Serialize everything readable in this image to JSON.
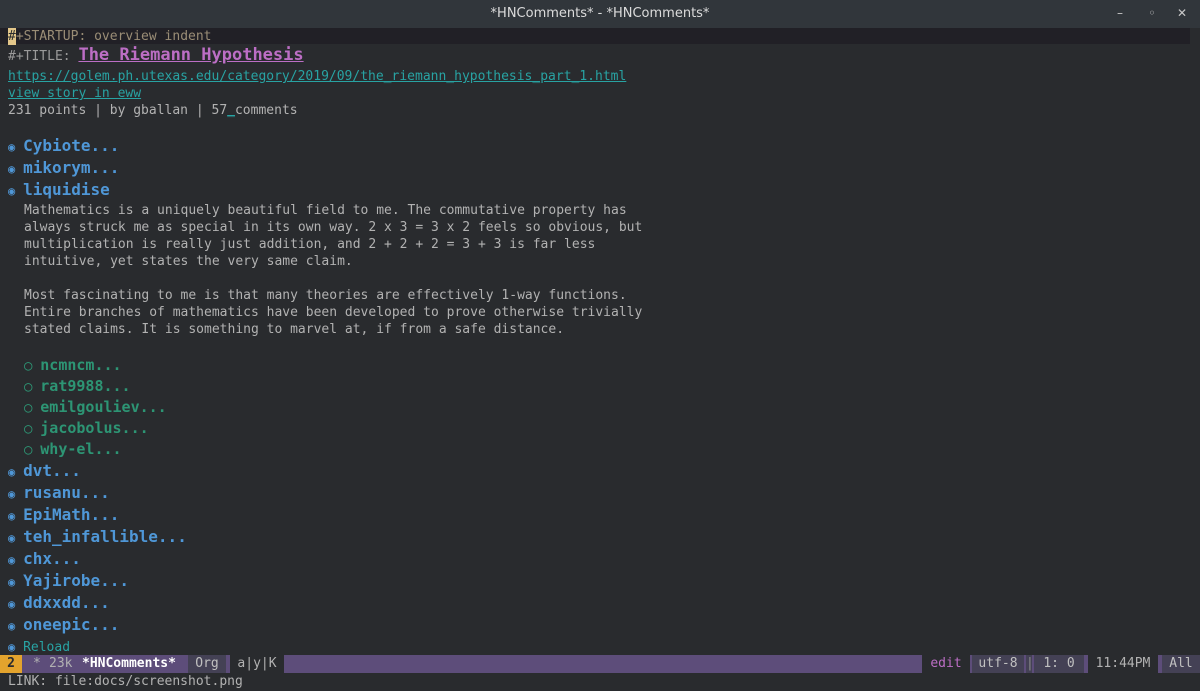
{
  "window": {
    "title": "*HNComments* - *HNComments*",
    "minimize_glyph": "–",
    "restore_glyph": "◦",
    "close_glyph": "✕"
  },
  "buffer": {
    "startup_cursor_char": "#",
    "startup_rest": "+STARTUP: overview indent",
    "title_keyword": "#+TITLE: ",
    "title": "The Riemann Hypothesis",
    "url": "https://golem.ph.utexas.edu/category/2019/09/the_riemann_hypothesis_part_1.html",
    "eww_link": "view story in eww",
    "stats_prefix": "231 points | by gballan | 57",
    "stats_link": "_",
    "stats_suffix": "comments",
    "top_comments": [
      {
        "author": "Cybiote..."
      },
      {
        "author": "mikorym..."
      },
      {
        "author": "liquidise"
      }
    ],
    "comment_body": [
      "Mathematics is a uniquely beautiful field to me. The commutative property has",
      "always struck me as special in its own way. 2 x 3 = 3 x 2 feels so obvious, but",
      "multiplication is really just addition, and 2 + 2 + 2 = 3 + 3 is far less",
      "intuitive, yet states the very same claim.",
      "",
      "Most fascinating to me is that many theories are effectively 1-way functions.",
      "Entire branches of mathematics have been developed to prove otherwise trivially",
      "stated claims. It is something to marvel at, if from a safe distance."
    ],
    "replies": [
      {
        "author": "ncmncm..."
      },
      {
        "author": "rat9988..."
      },
      {
        "author": "emilgouliev..."
      },
      {
        "author": "jacobolus..."
      },
      {
        "author": "why-el..."
      }
    ],
    "more_comments": [
      {
        "author": "dvt..."
      },
      {
        "author": "rusanu..."
      },
      {
        "author": "EpiMath..."
      },
      {
        "author": "teh_infallible..."
      },
      {
        "author": "chx..."
      },
      {
        "author": "Yajirobe..."
      },
      {
        "author": "ddxxdd..."
      },
      {
        "author": "oneepic..."
      }
    ],
    "reload_label": "Reload",
    "bullet_top": "◉",
    "bullet_reply": "○"
  },
  "modeline": {
    "window_number": "2",
    "modified_marker": "*",
    "size": "23k",
    "buffer_name": "*HNComments*",
    "major_mode": "Org",
    "minor_modes": "a|y|K",
    "state": "edit",
    "encoding": "utf-8",
    "position": "1: 0",
    "time": "11:44PM",
    "scroll": "All"
  },
  "echo": {
    "text": "LINK: file:docs/screenshot.png"
  },
  "colors": {
    "background": "#292b2e",
    "heading1": "#4f97d7",
    "heading2": "#2d9574",
    "title": "#bc6ec5",
    "link": "#28a3a3",
    "modeline": "#5d4d7a",
    "window_number": "#e3a32d"
  }
}
